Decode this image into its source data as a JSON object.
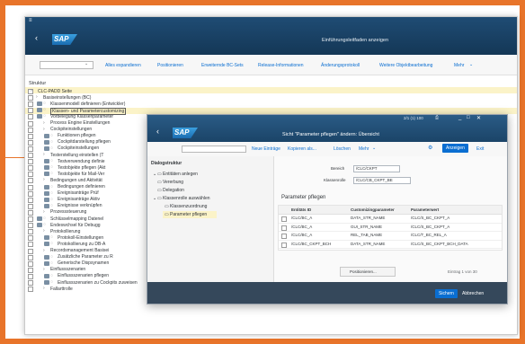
{
  "window_title": "Einführungsleitfaden anzeigen",
  "logo": "SAP",
  "toolbar": {
    "items": [
      "Alles expandieren",
      "Positionieren",
      "Erweiternde BC-Sets",
      "Release-Informationen",
      "Änderungsprotokoll",
      "Weitere Objektbearbeitung",
      "Mehr"
    ]
  },
  "structure_label": "Struktur",
  "tree": [
    {
      "label": "CLC-PADD Seite"
    },
    {
      "label": "Basiseinstellungen (BC)"
    },
    {
      "label": "Klassenmodell definieren (Entwickler)"
    },
    {
      "label": "Klassen- und Parametercustomizing"
    },
    {
      "label": "Vorbelegung Klassenparameter"
    },
    {
      "label": "Process Engine Einstellungen"
    },
    {
      "label": "Cockpiteinstellungen"
    },
    {
      "label": "Funktionen pflegen"
    },
    {
      "label": "Cockpitdarstellung pflegen"
    },
    {
      "label": "Cockpiteinstellungen"
    },
    {
      "label": "Testerstellung einstellen (T"
    },
    {
      "label": "Testverwendung definie"
    },
    {
      "label": "Testobjekte pflegen (Akt"
    },
    {
      "label": "Testobjekte für Mail-Ver"
    },
    {
      "label": "Bedingungen und Aktivität"
    },
    {
      "label": "Bedingungen definieren"
    },
    {
      "label": "Ereignisanträge Prüf"
    },
    {
      "label": "Ereignisanträge Aktiv"
    },
    {
      "label": "Ereignisse verknüpfen"
    },
    {
      "label": "Prozesssteuerung"
    },
    {
      "label": "Schlüsselmapping Datenel"
    },
    {
      "label": "Endeswchsel für Debugg"
    },
    {
      "label": "Protokollierung"
    },
    {
      "label": "Protokoll-Einstellungen"
    },
    {
      "label": "Protokollierung zu DB-A"
    },
    {
      "label": "Recordsmanagement Basisei"
    },
    {
      "label": "Zusätzliche Parameter zu R"
    },
    {
      "label": "Generische Dispsynamen"
    },
    {
      "label": "Einflussszenarien"
    },
    {
      "label": "Einflussszenarien pflegen"
    },
    {
      "label": "Einflussszenarien zu Cockpits zuweisen"
    },
    {
      "label": "Fallarttrolle"
    }
  ],
  "dialog": {
    "title": "Sicht \"Parameter pflegen\" ändern: Übersicht",
    "logo": "SAP",
    "pager": "2/1 (1) 100",
    "toolbar": {
      "new_entries": "Neue Einträge",
      "copy_as": "Kopieren als...",
      "delete": "Löschen",
      "more": "Mehr",
      "display": "Anzeigen",
      "exit": "Exit"
    },
    "nav_title": "Dialogstruktur",
    "nav_items": [
      "Entitäten anlegen",
      "Vererbung",
      "Delegation",
      "Klassenrolle auswählen",
      "Klassenzuordnung",
      "Parameter pflegen"
    ],
    "bereich_label": "Bereich",
    "bereich_value": "/CLC/CKPT",
    "klassenrolle_label": "Klassenrolle",
    "klassenrolle_value": "/CLC/CB_CKPT_BE",
    "table_title": "Parameter pflegen",
    "columns": [
      "Entitäts ID",
      "Customizingparameter",
      "Parameterwert"
    ],
    "rows": [
      [
        "/CLC/BC_A",
        "DATA_STR_NAME",
        "/CLC/S_BC_CKPT_A"
      ],
      [
        "/CLC/BC_A",
        "GUI_STR_NAME",
        "/CLC/S_BC_CKPT_A"
      ],
      [
        "/CLC/BC_A",
        "REL_TAB_NAME",
        "/CLC/T_BC_REL_A"
      ],
      [
        "/CLC/BC_CKPT_BCH",
        "DATA_STR_NAME",
        "/CLC/S_BC_CKPT_BCH_DATA"
      ]
    ],
    "position_button": "Positionieren...",
    "entry_count": "Eintrag 1 von 30",
    "save_button": "Sichern",
    "cancel_button": "Abbrechen"
  }
}
